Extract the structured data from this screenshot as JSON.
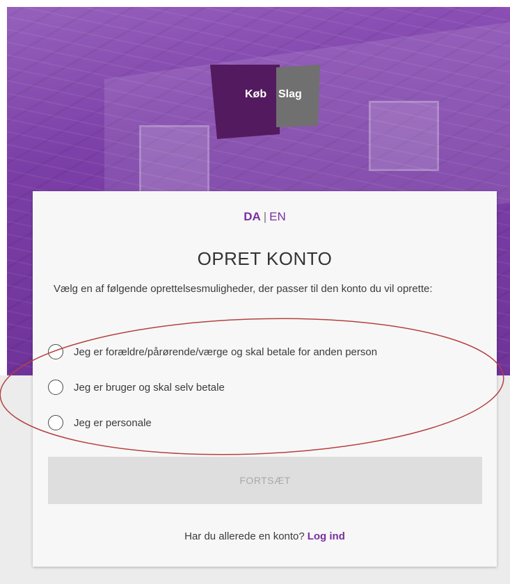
{
  "brand": {
    "left": "Køb",
    "right": "Slag"
  },
  "language": {
    "active": "DA",
    "separator": "|",
    "other": "EN"
  },
  "form": {
    "title": "OPRET KONTO",
    "intro": "Vælg en af følgende oprettelsesmuligheder, der passer til den konto du vil oprette:",
    "options": [
      {
        "label": "Jeg er forældre/pårørende/værge og skal betale for anden person",
        "selected": false
      },
      {
        "label": "Jeg er bruger og skal selv betale",
        "selected": false
      },
      {
        "label": "Jeg er personale",
        "selected": false
      }
    ],
    "continue_label": "FORTSÆT",
    "login_prompt": "Har du allerede en konto?",
    "login_link": "Log ind"
  },
  "colors": {
    "accent": "#7a2e9e",
    "hero": "#7a3ea6",
    "annotation": "#b5403f",
    "disabled_button": "#dedede"
  }
}
